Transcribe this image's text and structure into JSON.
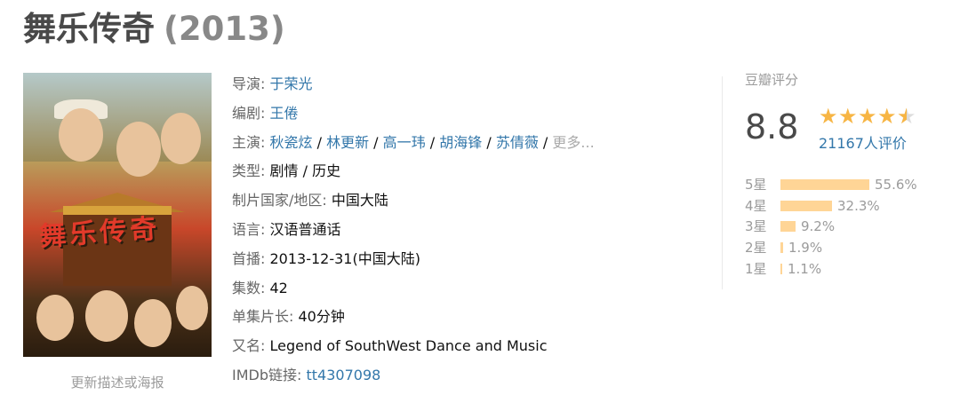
{
  "title": {
    "name": "舞乐传奇",
    "year": "(2013)"
  },
  "poster": {
    "logo_text": "舞乐传奇",
    "update_link": "更新描述或海报"
  },
  "info": {
    "director_label": "导演:",
    "director": "于荣光",
    "writer_label": "编剧:",
    "writer": "王倦",
    "cast_label": "主演:",
    "cast": [
      "秋瓷炫",
      "林更新",
      "高一玮",
      "胡海锋",
      "苏倩薇"
    ],
    "cast_more": "更多...",
    "genre_label": "类型:",
    "genre": "剧情 / 历史",
    "country_label": "制片国家/地区:",
    "country": "中国大陆",
    "language_label": "语言:",
    "language": "汉语普通话",
    "premiere_label": "首播:",
    "premiere": "2013-12-31(中国大陆)",
    "episodes_label": "集数:",
    "episodes": "42",
    "runtime_label": "单集片长:",
    "runtime": "40分钟",
    "aka_label": "又名:",
    "aka": "Legend of SouthWest Dance and Music",
    "imdb_label": "IMDb链接:",
    "imdb": "tt4307098"
  },
  "rating": {
    "header": "豆瓣评分",
    "score": "8.8",
    "stars": 4.5,
    "votes": "21167人评价",
    "star_color": "#f7b544",
    "bar_color": "#ffd596",
    "distribution": [
      {
        "label": "5星",
        "percent": "55.6%",
        "value": 55.6
      },
      {
        "label": "4星",
        "percent": "32.3%",
        "value": 32.3
      },
      {
        "label": "3星",
        "percent": "9.2%",
        "value": 9.2
      },
      {
        "label": "2星",
        "percent": "1.9%",
        "value": 1.9
      },
      {
        "label": "1星",
        "percent": "1.1%",
        "value": 1.1
      }
    ]
  },
  "colors": {
    "link": "#3377aa",
    "title": "#494949",
    "muted": "#9b9b9b"
  }
}
